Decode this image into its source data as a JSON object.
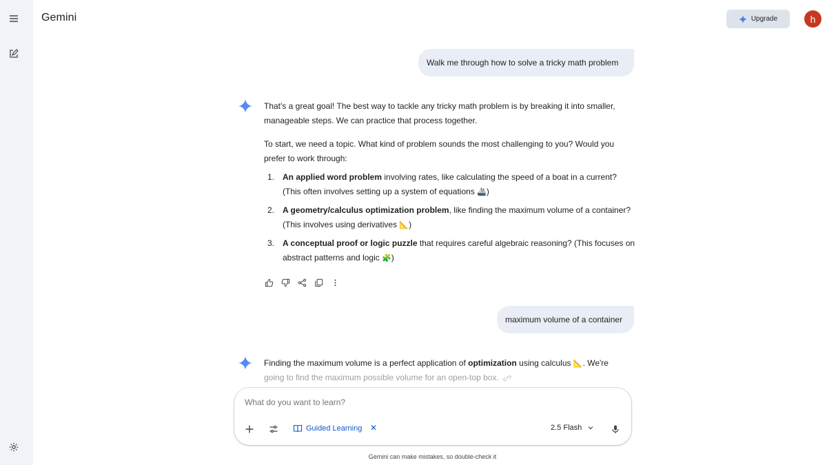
{
  "app": {
    "title": "Gemini"
  },
  "header": {
    "upgrade_label": "Upgrade",
    "avatar_letter": "h"
  },
  "icons": {
    "menu": "menu-icon",
    "new_chat": "edit-icon",
    "settings": "gear-icon",
    "spark": "gemini-spark-icon"
  },
  "conversation": {
    "user_1": "Walk me through how to solve a tricky math problem",
    "model_1": {
      "p1": "That's a great goal! The best way to tackle any tricky math problem is by breaking it into smaller, manageable steps. We can practice that process together.",
      "p2": "To start, we need a topic. What kind of problem sounds the most challenging to you? Would you prefer to work through:",
      "items": [
        {
          "num": "1.",
          "bold": "An applied word problem",
          "rest": " involving rates, like calculating the speed of a boat in a current? (This often involves setting up a system of equations ",
          "emoji": "🚢",
          "end": ")"
        },
        {
          "num": "2.",
          "bold": "A geometry/calculus optimization problem",
          "rest": ", like finding the maximum volume of a container? (This involves using derivatives ",
          "emoji": "📐",
          "end": ")"
        },
        {
          "num": "3.",
          "bold": "A conceptual proof or logic puzzle",
          "rest": " that requires careful algebraic reasoning? (This focuses on abstract patterns and logic ",
          "emoji": "🧩",
          "end": ")"
        }
      ]
    },
    "user_2": "maximum volume of a container",
    "model_2": {
      "pre": "Finding the maximum volume is a perfect application of ",
      "bold": "optimization",
      "post": " using calculus ",
      "emoji": "📐",
      "post2": ". We're",
      "line2": "going to find the maximum possible volume for an open-top box."
    }
  },
  "composer": {
    "placeholder": "What do you want to learn?",
    "guided_label": "Guided Learning",
    "model_label": "2.5 Flash"
  },
  "footer": {
    "disclaimer": "Gemini can make mistakes, so double-check it"
  },
  "colors": {
    "accent": "#0b57d0",
    "rail": "#f0f4f9",
    "bubble": "#e9eef6",
    "avatar": "#c5391f"
  }
}
